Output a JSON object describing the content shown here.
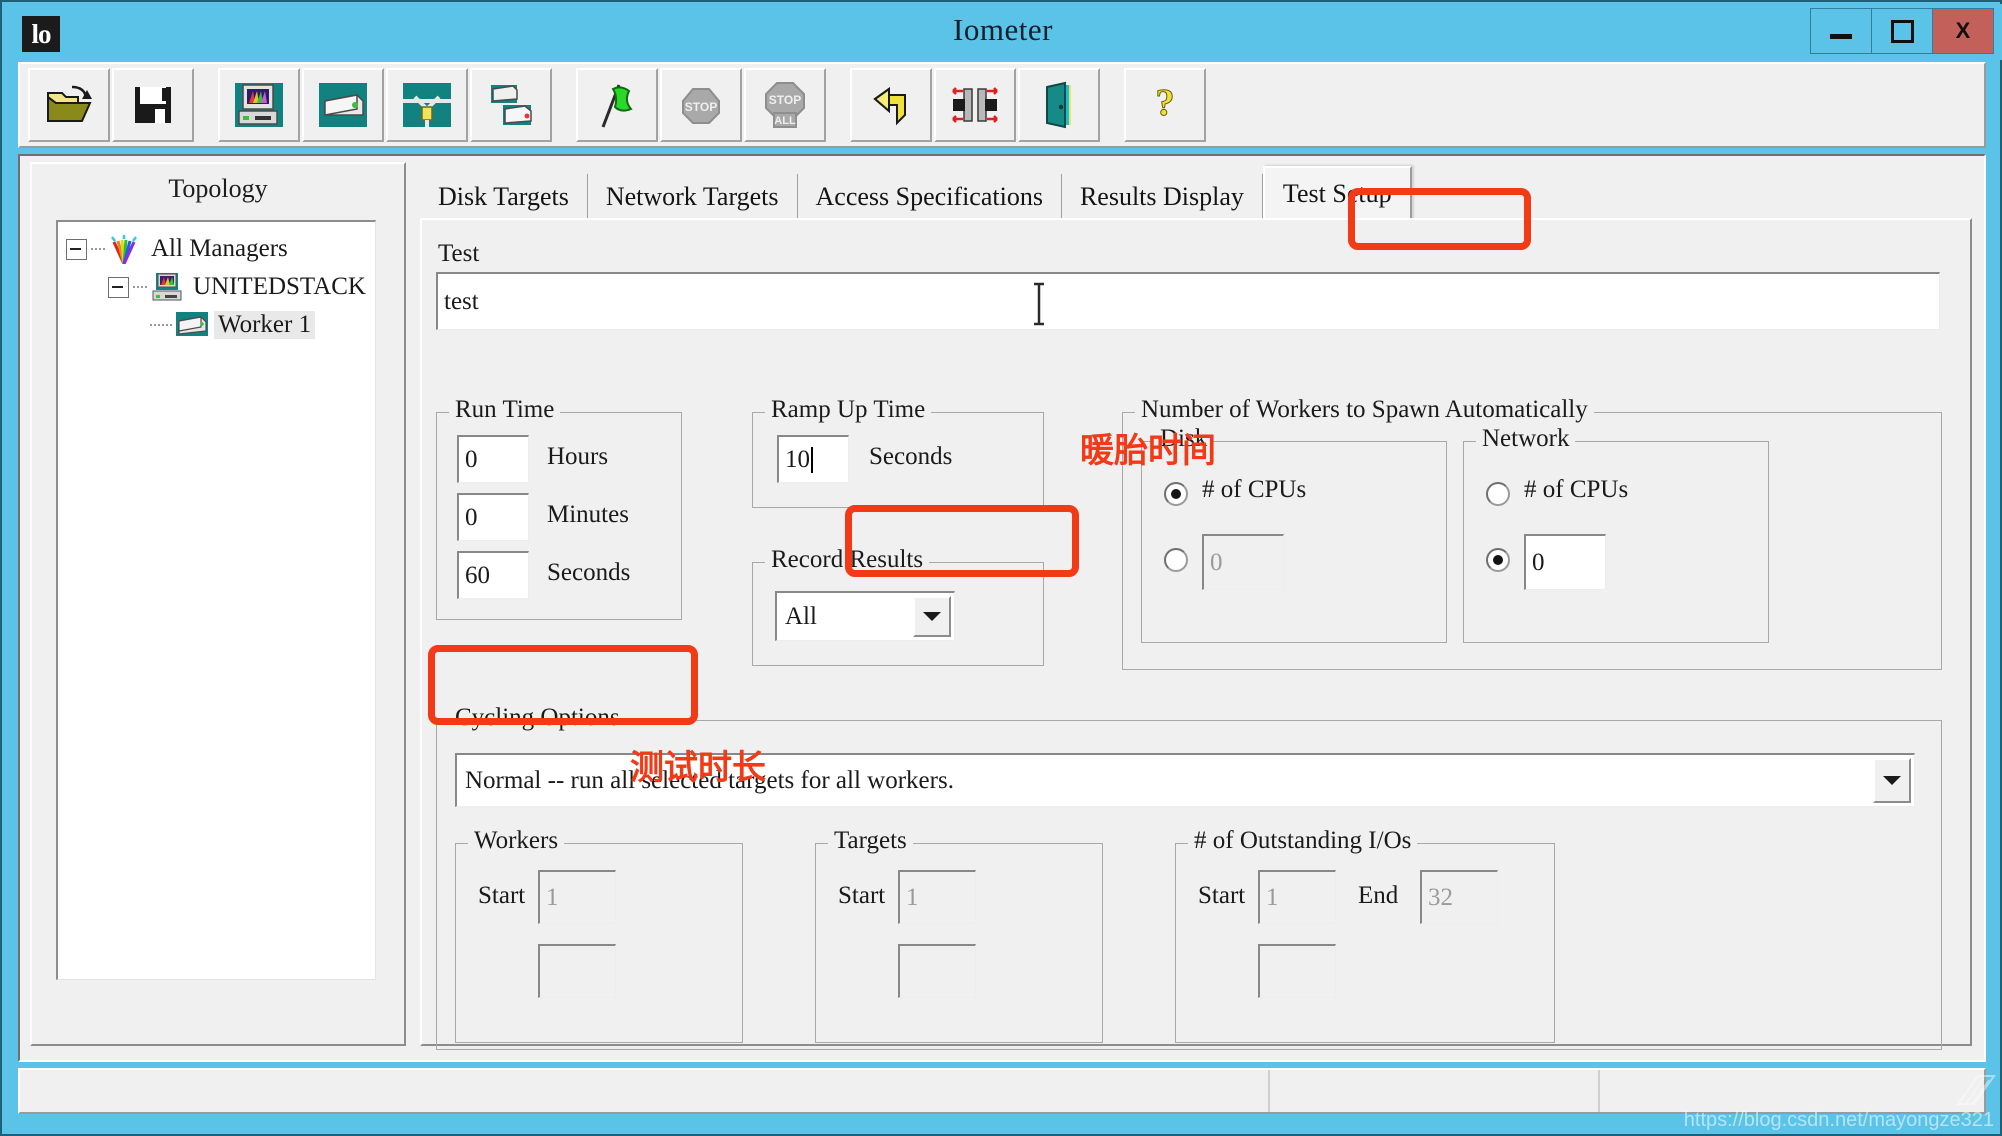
{
  "window": {
    "title": "Iometer",
    "app_icon_text": "lo",
    "minimize_label": "minimize",
    "maximize_label": "maximize",
    "close_label": "X",
    "titlebar_color": "#5bc3e8",
    "close_color": "#c4605a"
  },
  "toolbar": {
    "buttons": [
      {
        "name": "open-config-icon",
        "tooltip": "Open Test Configuration File"
      },
      {
        "name": "save-config-icon",
        "tooltip": "Save Test Configuration File"
      },
      {
        "name": "new-manager-icon",
        "tooltip": "Add New Manager"
      },
      {
        "name": "new-worker-icon",
        "tooltip": "Add New Worker"
      },
      {
        "name": "disconnect-icon",
        "tooltip": "Disconnect Selected Worker or Manager"
      },
      {
        "name": "duplicate-worker-icon",
        "tooltip": "Duplicate Selected Worker"
      },
      {
        "name": "start-tests-icon",
        "tooltip": "Start Tests"
      },
      {
        "name": "stop-test-icon",
        "tooltip": "Stop Current Test"
      },
      {
        "name": "stop-all-tests-icon",
        "tooltip": "Stop All Tests"
      },
      {
        "name": "reset-icon",
        "tooltip": "Reset Workers"
      },
      {
        "name": "swap-icon",
        "tooltip": "Swap"
      },
      {
        "name": "exit-icon",
        "tooltip": "Exit"
      },
      {
        "name": "help-icon",
        "tooltip": "Help"
      }
    ]
  },
  "topology": {
    "title": "Topology",
    "tree": [
      {
        "label": "All Managers",
        "level": 0,
        "icon": "all-managers-icon",
        "expanded": true,
        "selected": false
      },
      {
        "label": "UNITEDSTACK",
        "level": 1,
        "icon": "manager-icon",
        "expanded": true,
        "selected": false
      },
      {
        "label": "Worker 1",
        "level": 2,
        "icon": "worker-icon",
        "expanded": false,
        "selected": true
      }
    ]
  },
  "tabs": [
    {
      "label": "Disk Targets",
      "active": false
    },
    {
      "label": "Network Targets",
      "active": false
    },
    {
      "label": "Access Specifications",
      "active": false
    },
    {
      "label": "Results Display",
      "active": false
    },
    {
      "label": "Test Setup",
      "active": true
    }
  ],
  "test_setup": {
    "test_label": "Test",
    "test_value": "test",
    "run_time": {
      "title": "Run Time",
      "hours_value": "0",
      "hours_label": "Hours",
      "minutes_value": "0",
      "minutes_label": "Minutes",
      "seconds_value": "60",
      "seconds_label": "Seconds"
    },
    "ramp_up_time": {
      "title": "Ramp Up Time",
      "value": "10",
      "unit_label": "Seconds"
    },
    "record_results": {
      "title": "Record Results",
      "selected": "All"
    },
    "workers_spawn": {
      "title": "Number of Workers to Spawn Automatically",
      "disk": {
        "title": "Disk",
        "cpus_label": "# of CPUs",
        "cpus_selected": true,
        "count_value": "0",
        "count_selected": false
      },
      "network": {
        "title": "Network",
        "cpus_label": "# of CPUs",
        "cpus_selected": false,
        "count_value": "0",
        "count_selected": true
      }
    },
    "cycling_options": {
      "title": "Cycling Options",
      "selected": "Normal -- run all selected targets for all workers.",
      "workers": {
        "title": "Workers",
        "start_label": "Start",
        "start_value": "1"
      },
      "targets": {
        "title": "Targets",
        "start_label": "Start",
        "start_value": "1"
      },
      "outstanding_ios": {
        "title": "# of Outstanding I/Os",
        "start_label": "Start",
        "start_value": "1",
        "end_label": "End",
        "end_value": "32"
      }
    }
  },
  "annotations": [
    {
      "name": "anno-ramp-up-time",
      "text": "暖胎时间"
    },
    {
      "name": "anno-run-duration",
      "text": "测试时长"
    }
  ],
  "watermark": {
    "text": "https://blog.csdn.net/mayongze321"
  },
  "colors": {
    "annotation_red": "#f23a17",
    "title_blue": "#5bc3e8",
    "face": "#f0f0f0",
    "teal": "#11827f"
  }
}
